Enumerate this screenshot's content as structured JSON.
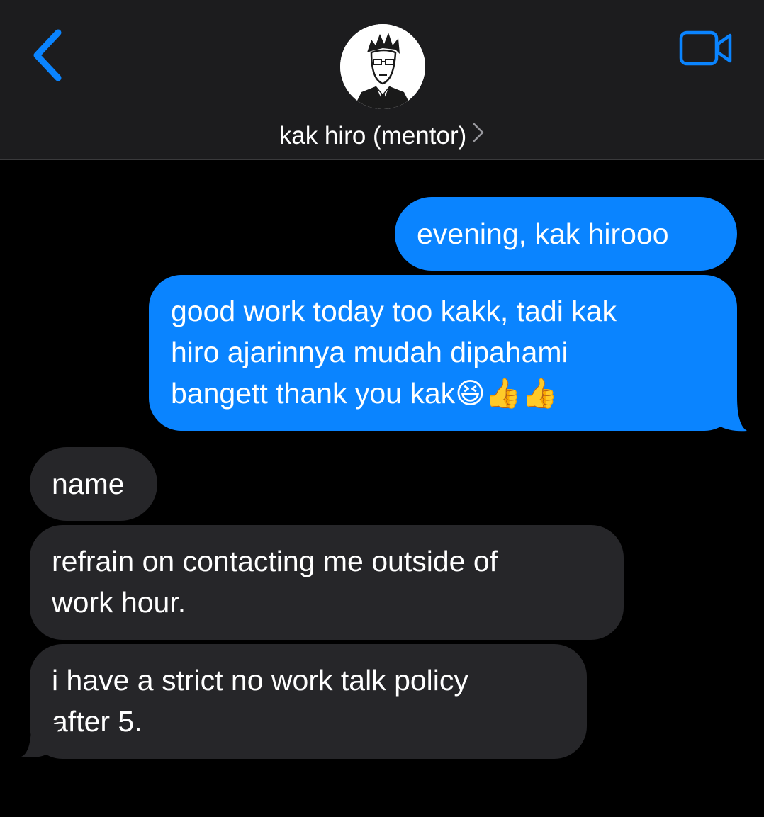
{
  "header": {
    "contact_name": "kak hiro (mentor)",
    "back_icon": "chevron-left-icon",
    "video_icon": "video-camera-icon",
    "accent_color": "#0a84ff"
  },
  "messages": [
    {
      "direction": "sent",
      "lines": [
        "evening, kak hirooo"
      ]
    },
    {
      "direction": "sent",
      "lines": [
        "good work today too kakk, tadi kak",
        "hiro ajarinnya mudah dipahami",
        "bangett thank you kak😆👍👍"
      ]
    },
    {
      "direction": "received",
      "lines": [
        "name"
      ]
    },
    {
      "direction": "received",
      "lines": [
        "refrain on contacting me outside of",
        "work hour."
      ]
    },
    {
      "direction": "received",
      "lines": [
        "i have a strict no work talk policy",
        "after 5."
      ]
    }
  ],
  "colors": {
    "sent_bubble": "#0a84ff",
    "received_bubble": "#262629",
    "header_bg": "#1c1c1e",
    "background": "#000000"
  }
}
